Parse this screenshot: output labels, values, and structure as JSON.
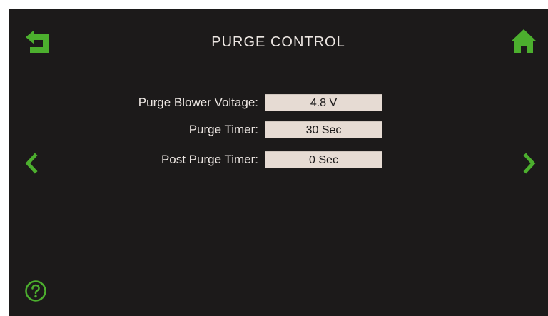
{
  "header": {
    "title": "PURGE CONTROL"
  },
  "colors": {
    "background": "#1c1a1a",
    "accent_green": "#4caf2e",
    "value_box": "#e6dbd3",
    "text": "#ece6e2"
  },
  "icons": {
    "back": "back-arrow-icon",
    "home": "home-icon",
    "previous": "chevron-left-icon",
    "next": "chevron-right-icon",
    "help": "help-circle-icon"
  },
  "settings": [
    {
      "label": "Purge Blower Voltage:",
      "value": "4.8 V"
    },
    {
      "label": "Purge Timer:",
      "value": "30 Sec"
    },
    {
      "label": "Post Purge Timer:",
      "value": "0 Sec"
    }
  ]
}
